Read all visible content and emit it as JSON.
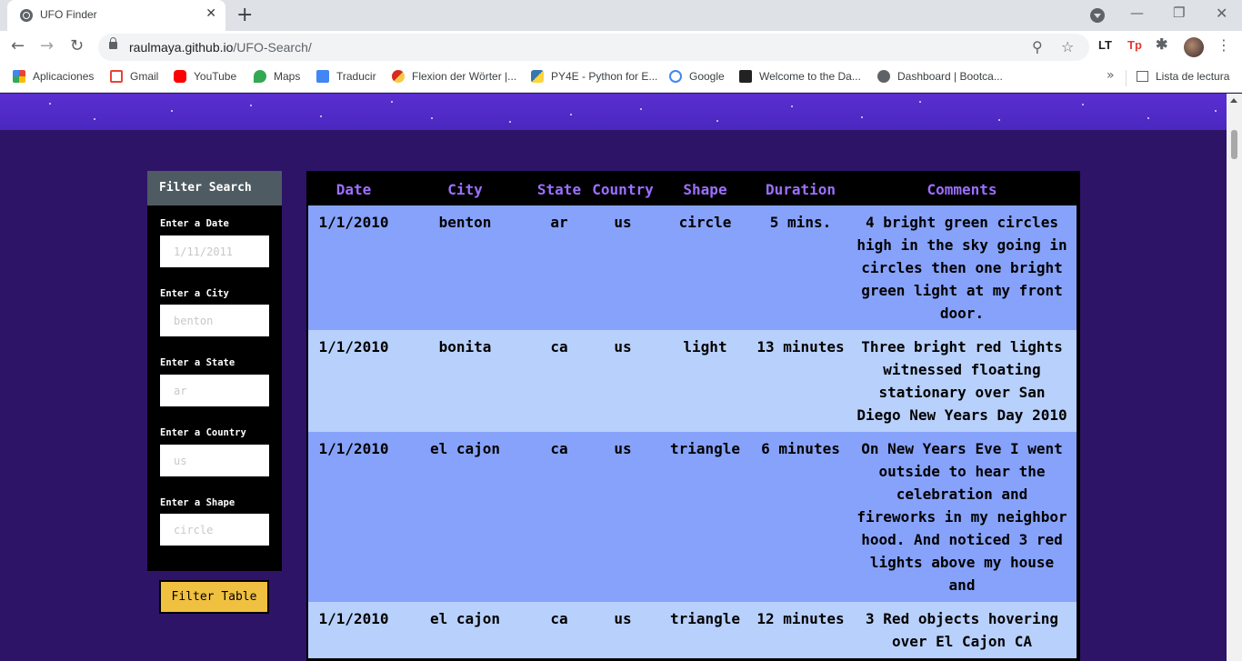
{
  "browser": {
    "tab_title": "UFO Finder",
    "url_host": "raulmaya.github.io",
    "url_path": "/UFO-Search/",
    "bookmarks": [
      {
        "label": "Aplicaciones",
        "icon": "apps-icon"
      },
      {
        "label": "Gmail",
        "icon": "gmail-icon"
      },
      {
        "label": "YouTube",
        "icon": "youtube-icon"
      },
      {
        "label": "Maps",
        "icon": "maps-icon"
      },
      {
        "label": "Traducir",
        "icon": "translate-icon"
      },
      {
        "label": "Flexion der Wörter |...",
        "icon": "flexion-icon"
      },
      {
        "label": "PY4E - Python for E...",
        "icon": "python-icon"
      },
      {
        "label": "Google",
        "icon": "google-icon"
      },
      {
        "label": "Welcome to the Da...",
        "icon": "book-icon"
      },
      {
        "label": "Dashboard | Bootca...",
        "icon": "globe-icon"
      }
    ],
    "more_bookmarks": "»",
    "reading_list": "Lista de lectura",
    "extensions": {
      "lt": "LT",
      "tp": "Tp"
    }
  },
  "filters": {
    "title": "Filter Search",
    "date": {
      "label": "Enter a Date",
      "placeholder": "1/11/2011"
    },
    "city": {
      "label": "Enter a City",
      "placeholder": "benton"
    },
    "state": {
      "label": "Enter a State",
      "placeholder": "ar"
    },
    "country": {
      "label": "Enter a Country",
      "placeholder": "us"
    },
    "shape": {
      "label": "Enter a Shape",
      "placeholder": "circle"
    },
    "button": "Filter Table"
  },
  "table": {
    "headers": {
      "date": "Date",
      "city": "City",
      "state": "State",
      "country": "Country",
      "shape": "Shape",
      "duration": "Duration",
      "comments": "Comments"
    },
    "rows": [
      {
        "date": "1/1/2010",
        "city": "benton",
        "state": "ar",
        "country": "us",
        "shape": "circle",
        "duration": "5 mins.",
        "comments": "4 bright green circles high in the sky going in circles then one bright green light at my front door."
      },
      {
        "date": "1/1/2010",
        "city": "bonita",
        "state": "ca",
        "country": "us",
        "shape": "light",
        "duration": "13 minutes",
        "comments": "Three bright red lights witnessed floating stationary over San Diego New Years Day 2010"
      },
      {
        "date": "1/1/2010",
        "city": "el cajon",
        "state": "ca",
        "country": "us",
        "shape": "triangle",
        "duration": "6 minutes",
        "comments": "On New Years Eve I went outside to hear the celebration and fireworks in my neighbor hood. And noticed 3 red lights above my house and"
      },
      {
        "date": "1/1/2010",
        "city": "el cajon",
        "state": "ca",
        "country": "us",
        "shape": "triangle",
        "duration": "12 minutes",
        "comments": "3 Red objects hovering over El Cajon CA"
      }
    ]
  },
  "colors": {
    "page_bg": "#2e1466",
    "hero": "#5a2fd0",
    "header_text": "#9b6fff",
    "row_odd": "#87a2fa",
    "row_even": "#b8d0fc",
    "button": "#f0c040"
  }
}
